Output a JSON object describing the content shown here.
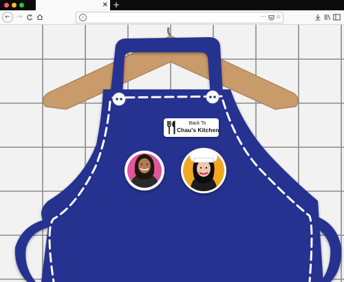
{
  "browser": {
    "tab_close": "✕",
    "new_tab": "+",
    "url": "",
    "colors": {
      "tabbar": "#0c0c0d",
      "close": "#ff5f57",
      "minimize": "#ffbd2e",
      "zoom": "#28c840"
    }
  },
  "page": {
    "background": "#f2f2f2",
    "grid_color": "#8a8a8a",
    "apron_color": "#26318f",
    "stitch_color": "#ffffff",
    "hanger_color": "#c99a6a",
    "badge": {
      "line1": "Back To",
      "line2": "Chau's Kitchen"
    },
    "buttons": [
      {
        "name": "avatar-button-photo",
        "background": "#e0559b"
      },
      {
        "name": "avatar-button-chef",
        "background": "#f0a821"
      }
    ]
  }
}
